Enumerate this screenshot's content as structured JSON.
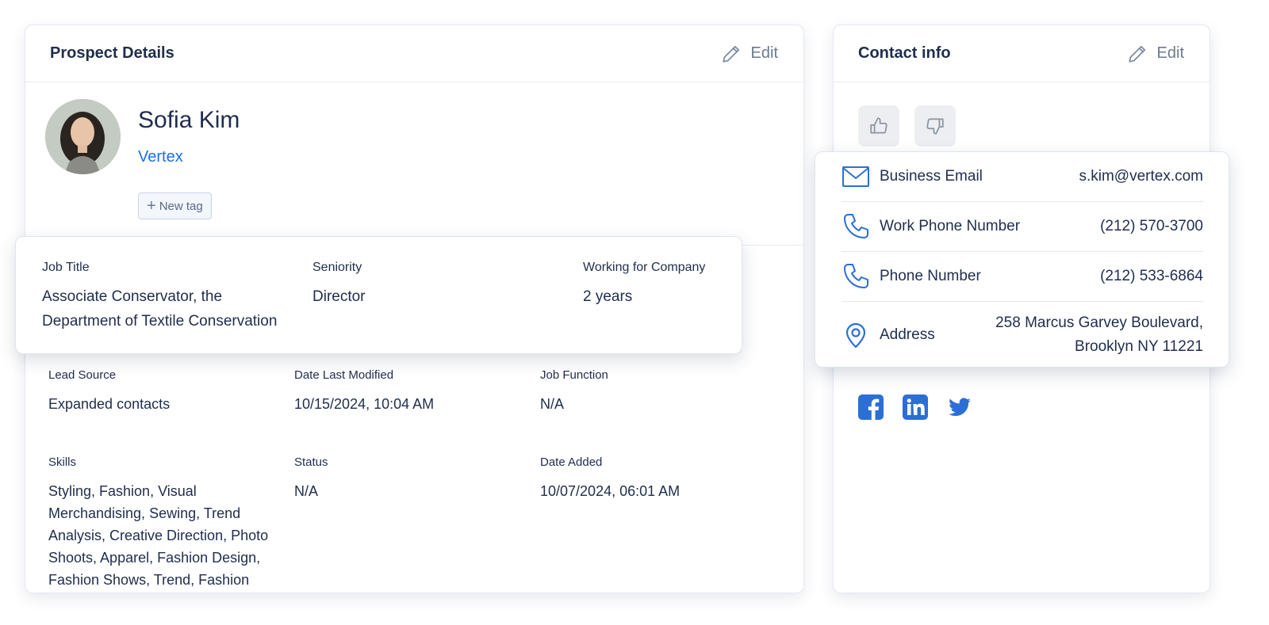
{
  "colors": {
    "accent": "#1a6fe8",
    "icon_blue": "#2b6fd6",
    "text": "#1f2d4d",
    "muted": "#6b7a90"
  },
  "prospect": {
    "title": "Prospect Details",
    "edit_label": "Edit",
    "name": "Sofia Kim",
    "company": "Vertex",
    "new_tag_label": "New tag",
    "job": {
      "job_title_label": "Job Title",
      "job_title_value": "Associate Conservator, the Department of Textile Conservation",
      "seniority_label": "Seniority",
      "seniority_value": "Director",
      "working_label": "Working for Company",
      "working_value": "2 years"
    },
    "details": {
      "lead_source_label": "Lead Source",
      "lead_source_value": "Expanded contacts",
      "date_modified_label": "Date Last Modified",
      "date_modified_value": "10/15/2024, 10:04 AM",
      "job_function_label": "Job Function",
      "job_function_value": "N/A",
      "skills_label": "Skills",
      "skills_value": "Styling, Fashion, Visual Merchandising, Sewing, Trend Analysis, Creative Direction, Photo Shoots, Apparel, Fashion Design, Fashion Shows, Trend, Fashion",
      "status_label": "Status",
      "status_value": "N/A",
      "date_added_label": "Date Added",
      "date_added_value": "10/07/2024, 06:01 AM"
    }
  },
  "contact": {
    "title": "Contact info",
    "edit_label": "Edit",
    "thumbs_up_icon": "thumbs-up-icon",
    "thumbs_down_icon": "thumbs-down-icon",
    "rows": [
      {
        "icon": "mail-icon",
        "label": "Business Email",
        "value": "s.kim@vertex.com"
      },
      {
        "icon": "phone-icon",
        "label": "Work Phone Number",
        "value": "(212) 570-3700"
      },
      {
        "icon": "phone-icon",
        "label": "Phone Number",
        "value": "(212) 533-6864"
      },
      {
        "icon": "location-pin-icon",
        "label": "Address",
        "value": "258 Marcus Garvey Boulevard, Brooklyn NY 11221"
      }
    ],
    "socials": [
      "facebook-icon",
      "linkedin-icon",
      "twitter-icon"
    ]
  }
}
